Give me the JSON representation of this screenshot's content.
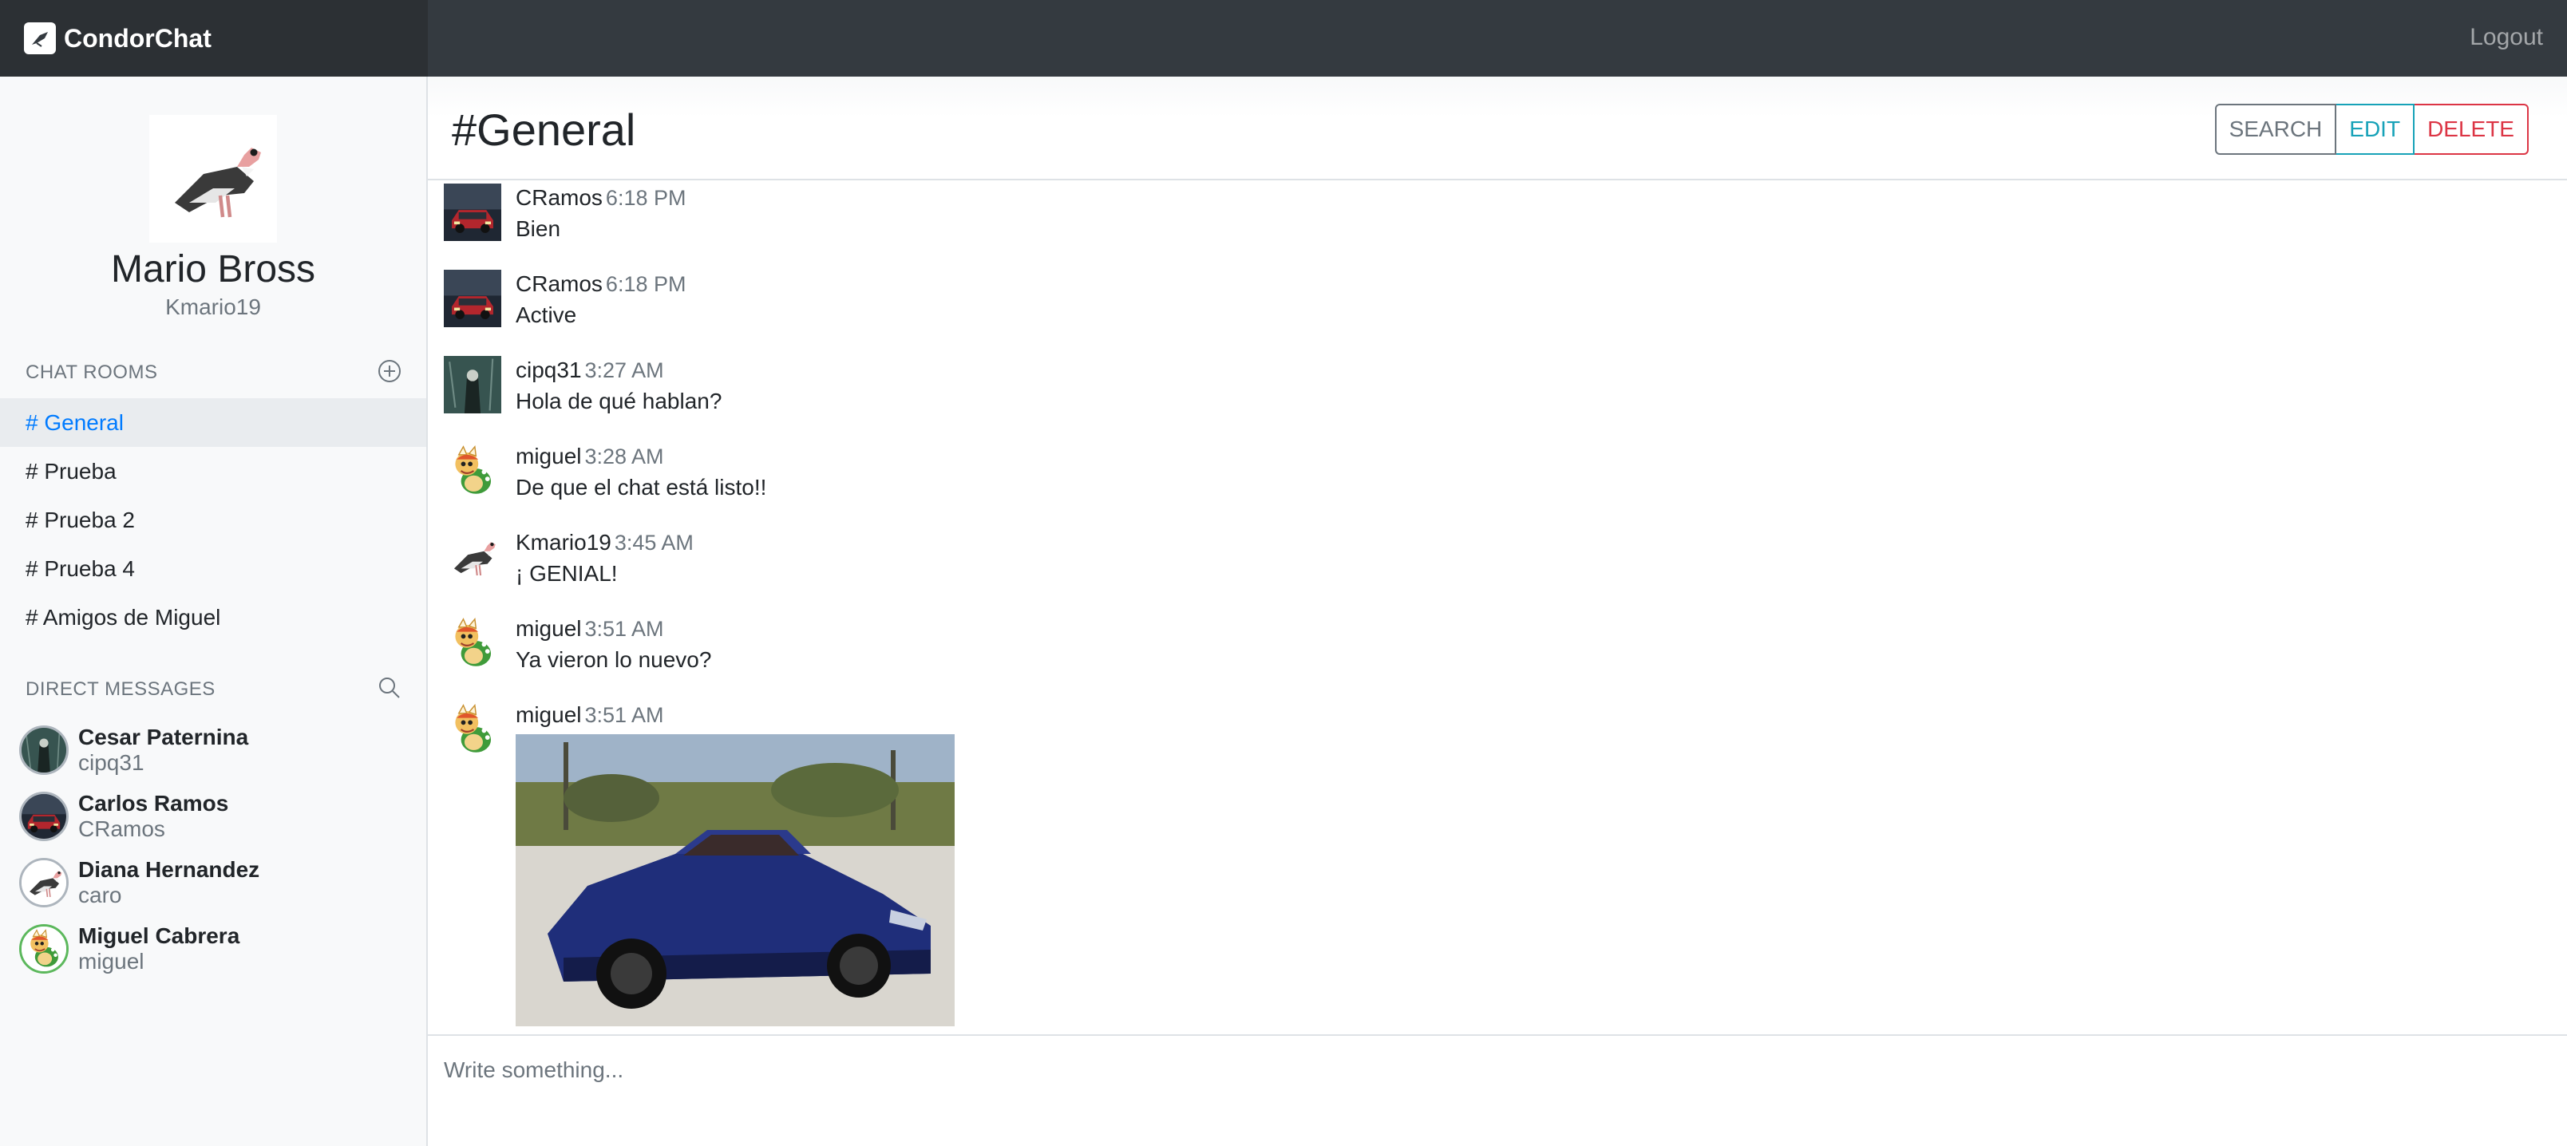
{
  "app": {
    "name": "CondorChat",
    "logout_label": "Logout"
  },
  "profile": {
    "name": "Mario Bross",
    "username": "Kmario19"
  },
  "sidebar": {
    "rooms_header": "CHAT ROOMS",
    "rooms": [
      {
        "label": "# General",
        "active": true
      },
      {
        "label": "# Prueba",
        "active": false
      },
      {
        "label": "# Prueba 2",
        "active": false
      },
      {
        "label": "# Prueba 4",
        "active": false
      },
      {
        "label": "# Amigos de Miguel",
        "active": false
      }
    ],
    "dm_header": "DIRECT MESSAGES",
    "dms": [
      {
        "name": "Cesar Paternina",
        "username": "cipq31",
        "avatar": "dark-figure"
      },
      {
        "name": "Carlos Ramos",
        "username": "CRamos",
        "avatar": "red-car"
      },
      {
        "name": "Diana Hernandez",
        "username": "caro",
        "avatar": "condor"
      },
      {
        "name": "Miguel Cabrera",
        "username": "miguel",
        "avatar": "bowser"
      }
    ]
  },
  "channel": {
    "title": "#General",
    "buttons": {
      "search": "SEARCH",
      "edit": "EDIT",
      "delete": "DELETE"
    }
  },
  "messages": [
    {
      "author": "CRamos",
      "time": "6:18 PM",
      "text": "Bien",
      "avatar": "red-car"
    },
    {
      "author": "CRamos",
      "time": "6:18 PM",
      "text": "Active",
      "avatar": "red-car"
    },
    {
      "author": "cipq31",
      "time": "3:27 AM",
      "text": "Hola de qué hablan?",
      "avatar": "dark-figure"
    },
    {
      "author": "miguel",
      "time": "3:28 AM",
      "text": "De que el chat está listo!!",
      "avatar": "bowser"
    },
    {
      "author": "Kmario19",
      "time": "3:45 AM",
      "text": "¡ GENIAL!",
      "avatar": "condor"
    },
    {
      "author": "miguel",
      "time": "3:51 AM",
      "text": "Ya vieron lo nuevo?",
      "avatar": "bowser"
    },
    {
      "author": "miguel",
      "time": "3:51 AM",
      "text": "",
      "avatar": "bowser",
      "image": "blue-sports-car"
    }
  ],
  "composer": {
    "placeholder": "Write something..."
  }
}
